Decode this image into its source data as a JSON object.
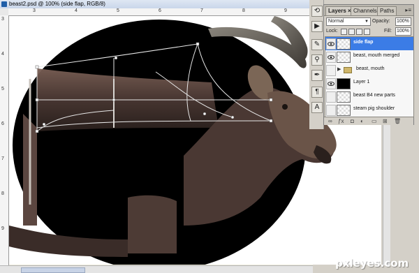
{
  "window": {
    "title": "beast2.psd @ 100% (side flap, RGB/8)"
  },
  "rulers": {
    "top": [
      "3",
      "4",
      "5",
      "6",
      "7",
      "8",
      "9"
    ],
    "left": [
      "3",
      "4",
      "5",
      "6",
      "7",
      "8",
      "9"
    ]
  },
  "layers_panel": {
    "tabs": [
      "Layers ×",
      "Channels",
      "Paths"
    ],
    "menu_icon": "menu-arrow-icon",
    "blend_mode": "Normal",
    "opacity_label": "Opacity:",
    "opacity_value": "100%",
    "lock_label": "Lock:",
    "fill_label": "Fill:",
    "fill_value": "100%",
    "layers": [
      {
        "name": "side flap",
        "visible": true,
        "selected": true,
        "thumb": "transparent"
      },
      {
        "name": "beast, mouth merged",
        "visible": true,
        "selected": false,
        "thumb": "transparent"
      },
      {
        "name": "beast, mouth",
        "visible": false,
        "selected": false,
        "thumb": "group"
      },
      {
        "name": "Layer 1",
        "visible": true,
        "selected": false,
        "thumb": "black"
      },
      {
        "name": "beast B4 new parts",
        "visible": false,
        "selected": false,
        "thumb": "transparent"
      },
      {
        "name": "steam pig shoulder",
        "visible": false,
        "selected": false,
        "thumb": "transparent"
      }
    ],
    "footer_icons": [
      "link-icon",
      "fx-icon",
      "mask-icon",
      "adjustment-icon",
      "folder-icon",
      "new-layer-icon",
      "trash-icon"
    ]
  },
  "tools": [
    "history-icon",
    "play-icon",
    "brush-icon",
    "clone-icon",
    "pen-icon",
    "text-icon",
    "type-icon"
  ],
  "colors": {
    "selection": "#3b7ce6",
    "canvas_black": "#000000"
  },
  "watermark": "pxleyes.com"
}
